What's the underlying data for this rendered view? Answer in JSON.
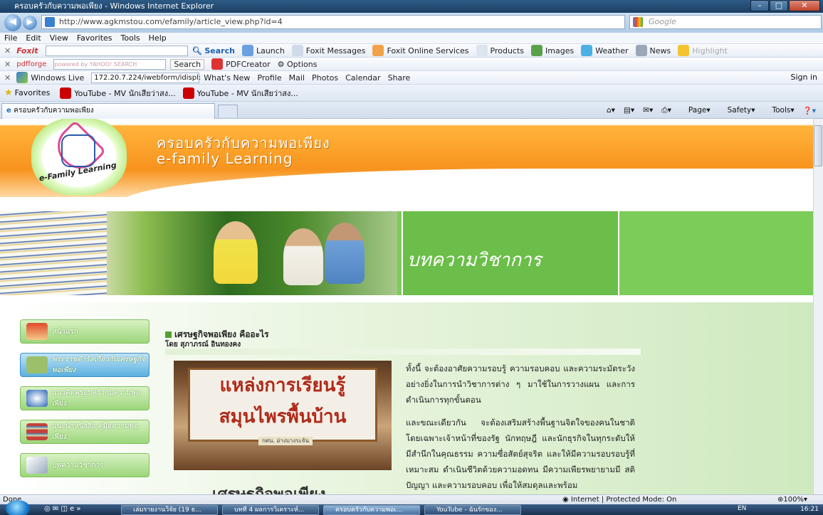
{
  "window": {
    "title": "ครอบครัวกับความพอเพียง - Windows Internet Explorer"
  },
  "address": {
    "url": "http://www.agkmstou.com/efamily/article_view.php?id=4",
    "search_placeholder": "Google"
  },
  "menubar": {
    "items": [
      "File",
      "Edit",
      "View",
      "Favorites",
      "Tools",
      "Help"
    ]
  },
  "foxit_toolbar": {
    "brand": "Foxit",
    "search": "Search",
    "items": [
      "Launch",
      "Foxit Messages",
      "Foxit Online Services",
      "Products",
      "Images",
      "Weather",
      "News",
      "Highlight"
    ]
  },
  "pdfforge_toolbar": {
    "brand": "pdfforge",
    "yahoo": "powered by YAHOO! SEARCH",
    "search": "Search",
    "pdfcreator": "PDFCreator",
    "options": "Options"
  },
  "live_toolbar": {
    "brand": "Windows Live",
    "input": "172.20.7.224/iwebform/idispl:",
    "items": [
      "What's New",
      "Profile",
      "Mail",
      "Photos",
      "Calendar",
      "Share"
    ],
    "signin": "Sign in"
  },
  "favorites": {
    "label": "Favorites",
    "items": [
      "YouTube - MV นักเสียว่าสง...",
      "YouTube - MV นักเสียว่าสง..."
    ]
  },
  "tab": {
    "label": "ครอบครัวกับความพอเพียง"
  },
  "commandbar": {
    "items": [
      "Page",
      "Safety",
      "Tools"
    ]
  },
  "site": {
    "title_th": "ครอบครัวกับความพอเพียง",
    "title_en": "e-family Learning",
    "logo_text": "e-Family Learning",
    "section_heading": "บทความวิชาการ"
  },
  "sidebar": {
    "items": [
      {
        "label": "หน้าแรก"
      },
      {
        "label": "พระราชดำรัสเกี่ยวกับเศรษฐกิจพอเพียง"
      },
      {
        "label": "แนวคิดครอบครัวกับความพอเพียง"
      },
      {
        "label": "แนะนำหนังสือ คู่มือความพอเพียง"
      },
      {
        "label": "บทความวิชาการ"
      }
    ]
  },
  "article": {
    "title": "เศรษฐกิจพอเพียง คืออะไร",
    "author": "โดย สุภาภรณ์ อินทองคง",
    "sign_line1": "แหล่งการเรียนรู้",
    "sign_line2": "สมุนไพรพื้นบ้าน",
    "sign_small": "กศน. อ่างบางระจัน",
    "big_title": "เศรษฐกิจพอเพียง",
    "para1": "ทั้งนี้ จะต้องอาศัยความรอบรู้ ความรอบคอบ และความระมัดระวัง อย่างยิ่งในการนำวิชาการต่าง ๆ มาใช้ในการวางแผน และการดำเนินการทุกขั้นตอน",
    "para2": "และขณะเดียวกัน จะต้องเสริมสร้างพื้นฐานจิตใจของคนในชาติ โดยเฉพาะเจ้าหน้าที่ของรัฐ นักทฤษฎี และนักธุรกิจในทุกระดับให้มีสำนึกในคุณธรรม ความซื่อสัตย์สุจริต และให้มีความรอบรอบรู้ที่เหมาะสม ดำเนินชีวิตด้วยความอดทน มีความเพียรพยายามมี สติปัญญา และความรอบคอบ เพื่อให้สมดุลและพร้อม"
  },
  "status": {
    "left": "Done",
    "zone": "Internet | Protected Mode: On",
    "zoom": "100%"
  },
  "taskbar": {
    "tasks": [
      "เล่มรายงานวิจัย (19 ธ...",
      "บทที่ 4 ผลการวิเคราะห์...",
      "ครอบครัวกับความพอเ...",
      "YouTube - ฉันรักของ..."
    ],
    "lang": "EN",
    "time": "16:21"
  },
  "colors": {
    "orange": "#f7931e",
    "green": "#7ccc5a",
    "ie_blue": "#2c5a85"
  }
}
